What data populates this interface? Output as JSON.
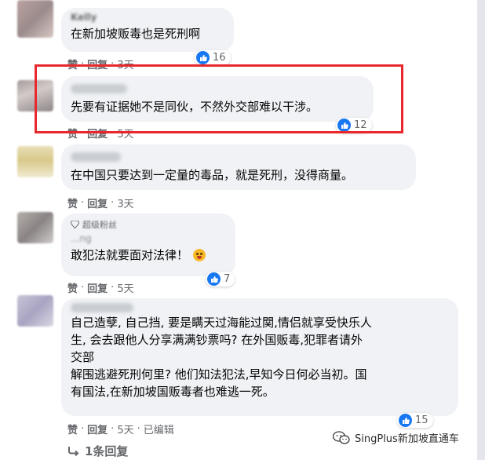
{
  "comments": [
    {
      "name": "Kelly",
      "text": "在新加坡贩毒也是死刑啊",
      "like": "赞",
      "reply": "回复",
      "time": "3天",
      "reactions": "16"
    },
    {
      "text": "先要有证据她不是同伙，不然外交部难以干涉。",
      "like": "赞",
      "reply": "回复",
      "time": "5天",
      "reactions": "12"
    },
    {
      "text": "在中国只要达到一定量的毒品，就是死刑，没得商量。",
      "like": "赞",
      "reply": "回复",
      "time": "3天"
    },
    {
      "badge": "超级粉丝",
      "name_partial": "...ng",
      "text": "敢犯法就要面对法律！",
      "like": "赞",
      "reply": "回复",
      "time": "5天",
      "reactions": "7"
    },
    {
      "text_lines": [
        "自己造孽, 自己挡, 要是瞒天过海能过関,情侣就享受快乐人",
        "生, 会去跟他人分享满满钞票吗? 在外国贩毒,犯罪者请外",
        "交部",
        "解围逃避死刑何里? 他们知法犯法,早知今日何必当初。国",
        "有国法,在新加坡国贩毒者也难逃一死。"
      ],
      "like": "赞",
      "reply": "回复",
      "time": "5天",
      "edited": "已编辑",
      "reactions": "15"
    }
  ],
  "replies_label": "1条回复",
  "watermark": "SingPlus新加坡直通车",
  "colors": {
    "bubble": "#f0f2f5",
    "like_blue": "#1877f2",
    "highlight_red": "#e8282d",
    "meta_gray": "#65676b"
  },
  "icons": {
    "reaction": "thumbs-up-icon",
    "reply_arrow": "reply-arrow-icon",
    "badge": "diamond-icon",
    "emoji": "tongue-out-emoji-icon",
    "watermark_logo": "wechat-icon"
  }
}
